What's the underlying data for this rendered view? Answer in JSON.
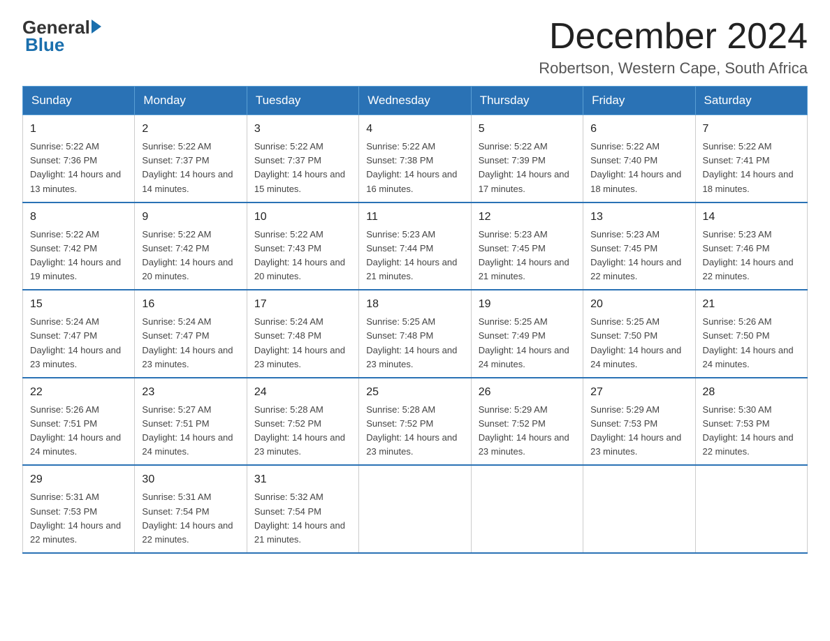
{
  "logo": {
    "general": "General",
    "blue": "Blue"
  },
  "title": "December 2024",
  "subtitle": "Robertson, Western Cape, South Africa",
  "headers": [
    "Sunday",
    "Monday",
    "Tuesday",
    "Wednesday",
    "Thursday",
    "Friday",
    "Saturday"
  ],
  "weeks": [
    [
      {
        "day": "1",
        "sunrise": "5:22 AM",
        "sunset": "7:36 PM",
        "daylight": "14 hours and 13 minutes."
      },
      {
        "day": "2",
        "sunrise": "5:22 AM",
        "sunset": "7:37 PM",
        "daylight": "14 hours and 14 minutes."
      },
      {
        "day": "3",
        "sunrise": "5:22 AM",
        "sunset": "7:37 PM",
        "daylight": "14 hours and 15 minutes."
      },
      {
        "day": "4",
        "sunrise": "5:22 AM",
        "sunset": "7:38 PM",
        "daylight": "14 hours and 16 minutes."
      },
      {
        "day": "5",
        "sunrise": "5:22 AM",
        "sunset": "7:39 PM",
        "daylight": "14 hours and 17 minutes."
      },
      {
        "day": "6",
        "sunrise": "5:22 AM",
        "sunset": "7:40 PM",
        "daylight": "14 hours and 18 minutes."
      },
      {
        "day": "7",
        "sunrise": "5:22 AM",
        "sunset": "7:41 PM",
        "daylight": "14 hours and 18 minutes."
      }
    ],
    [
      {
        "day": "8",
        "sunrise": "5:22 AM",
        "sunset": "7:42 PM",
        "daylight": "14 hours and 19 minutes."
      },
      {
        "day": "9",
        "sunrise": "5:22 AM",
        "sunset": "7:42 PM",
        "daylight": "14 hours and 20 minutes."
      },
      {
        "day": "10",
        "sunrise": "5:22 AM",
        "sunset": "7:43 PM",
        "daylight": "14 hours and 20 minutes."
      },
      {
        "day": "11",
        "sunrise": "5:23 AM",
        "sunset": "7:44 PM",
        "daylight": "14 hours and 21 minutes."
      },
      {
        "day": "12",
        "sunrise": "5:23 AM",
        "sunset": "7:45 PM",
        "daylight": "14 hours and 21 minutes."
      },
      {
        "day": "13",
        "sunrise": "5:23 AM",
        "sunset": "7:45 PM",
        "daylight": "14 hours and 22 minutes."
      },
      {
        "day": "14",
        "sunrise": "5:23 AM",
        "sunset": "7:46 PM",
        "daylight": "14 hours and 22 minutes."
      }
    ],
    [
      {
        "day": "15",
        "sunrise": "5:24 AM",
        "sunset": "7:47 PM",
        "daylight": "14 hours and 23 minutes."
      },
      {
        "day": "16",
        "sunrise": "5:24 AM",
        "sunset": "7:47 PM",
        "daylight": "14 hours and 23 minutes."
      },
      {
        "day": "17",
        "sunrise": "5:24 AM",
        "sunset": "7:48 PM",
        "daylight": "14 hours and 23 minutes."
      },
      {
        "day": "18",
        "sunrise": "5:25 AM",
        "sunset": "7:48 PM",
        "daylight": "14 hours and 23 minutes."
      },
      {
        "day": "19",
        "sunrise": "5:25 AM",
        "sunset": "7:49 PM",
        "daylight": "14 hours and 24 minutes."
      },
      {
        "day": "20",
        "sunrise": "5:25 AM",
        "sunset": "7:50 PM",
        "daylight": "14 hours and 24 minutes."
      },
      {
        "day": "21",
        "sunrise": "5:26 AM",
        "sunset": "7:50 PM",
        "daylight": "14 hours and 24 minutes."
      }
    ],
    [
      {
        "day": "22",
        "sunrise": "5:26 AM",
        "sunset": "7:51 PM",
        "daylight": "14 hours and 24 minutes."
      },
      {
        "day": "23",
        "sunrise": "5:27 AM",
        "sunset": "7:51 PM",
        "daylight": "14 hours and 24 minutes."
      },
      {
        "day": "24",
        "sunrise": "5:28 AM",
        "sunset": "7:52 PM",
        "daylight": "14 hours and 23 minutes."
      },
      {
        "day": "25",
        "sunrise": "5:28 AM",
        "sunset": "7:52 PM",
        "daylight": "14 hours and 23 minutes."
      },
      {
        "day": "26",
        "sunrise": "5:29 AM",
        "sunset": "7:52 PM",
        "daylight": "14 hours and 23 minutes."
      },
      {
        "day": "27",
        "sunrise": "5:29 AM",
        "sunset": "7:53 PM",
        "daylight": "14 hours and 23 minutes."
      },
      {
        "day": "28",
        "sunrise": "5:30 AM",
        "sunset": "7:53 PM",
        "daylight": "14 hours and 22 minutes."
      }
    ],
    [
      {
        "day": "29",
        "sunrise": "5:31 AM",
        "sunset": "7:53 PM",
        "daylight": "14 hours and 22 minutes."
      },
      {
        "day": "30",
        "sunrise": "5:31 AM",
        "sunset": "7:54 PM",
        "daylight": "14 hours and 22 minutes."
      },
      {
        "day": "31",
        "sunrise": "5:32 AM",
        "sunset": "7:54 PM",
        "daylight": "14 hours and 21 minutes."
      },
      null,
      null,
      null,
      null
    ]
  ]
}
